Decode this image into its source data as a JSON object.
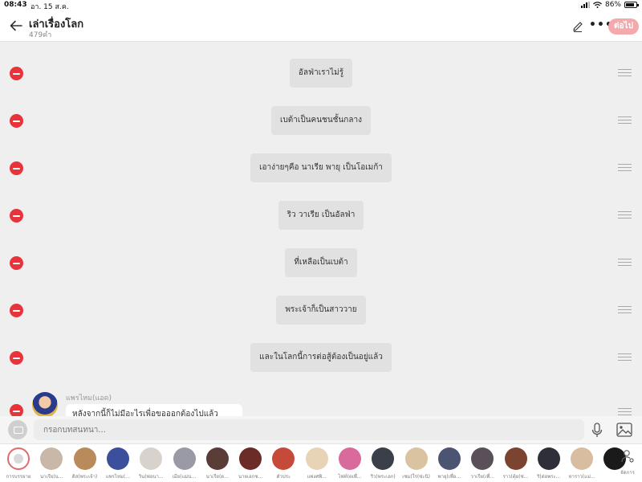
{
  "status": {
    "time": "08:43",
    "date": "อา. 15 ส.ค.",
    "battery": "86%",
    "battery_level": 0.86
  },
  "header": {
    "title": "เล่าเรื่องโลก",
    "subtitle": "479คำ",
    "next_label": "ต่อไป"
  },
  "messages": [
    "อัลฟ่าเราไม่รู้",
    "เบต้าเป็นคนชนชั้นกลาง",
    "เอาง่ายๆคือ นาเรีย พายุ เป็นโอเมก้า",
    "ริว วาเรีย เป็นอัลฟ่า",
    "ที่เหลือเป็นเบต้า",
    "พระเจ้าก็เป็นสาววาย",
    "และในโลกนี้การต่อสู้ต้องเป็นอยู่แล้ว"
  ],
  "chat_message": {
    "name": "แพรไหม(แอด)",
    "text": "หลังจากนี้ก็ไม่มีอะไรเพื่อขอออกต้องไปแล้ว"
  },
  "input": {
    "placeholder": "กรอกบทสนทนา..."
  },
  "characters": [
    {
      "name": "การบรรยาย",
      "color": "#ffffff"
    },
    {
      "name": "นาเรีย(น...",
      "color": "#c9b8a8"
    },
    {
      "name": "ติส(พระเจ้า)",
      "color": "#b98a5a"
    },
    {
      "name": "แพรไหม(...",
      "color": "#3b4f9c"
    },
    {
      "name": "วิน(ฟอนา...",
      "color": "#d8d2cc"
    },
    {
      "name": "เมีย(แม่น...",
      "color": "#9a9aa6"
    },
    {
      "name": "นาเรีย(ด...",
      "color": "#5a3d36"
    },
    {
      "name": "นายเอกช...",
      "color": "#6b2c28"
    },
    {
      "name": "ตัวประ",
      "color": "#c54a3a"
    },
    {
      "name": "แพ่งศพิ...",
      "color": "#e9d3b6"
    },
    {
      "name": "ไฟท์(ตเพื่...",
      "color": "#d86a9c"
    },
    {
      "name": "ริว(พระเอก)",
      "color": "#3a3f4a"
    },
    {
      "name": "เซม(ใร(ซ่ะนิ)",
      "color": "#d9c3a1"
    },
    {
      "name": "พายุ(เพื่อ...",
      "color": "#4b5470"
    },
    {
      "name": "วาเรีย(เพื่...",
      "color": "#59505a"
    },
    {
      "name": "ราว(ตุ้ย(ซ่...",
      "color": "#7a4430"
    },
    {
      "name": "ริ(ต่อพระ...",
      "color": "#2f2f3a"
    },
    {
      "name": "หาราว(แม่...",
      "color": "#d8bda0"
    },
    {
      "name": "",
      "color": "#1a1a1a"
    }
  ],
  "settings_label": "จัดการ"
}
